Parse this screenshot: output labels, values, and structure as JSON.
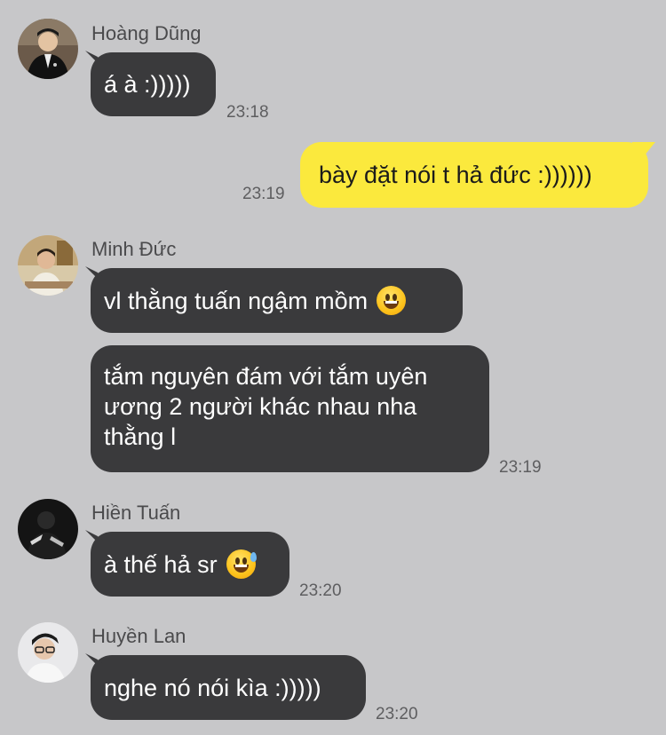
{
  "messages": [
    {
      "sender": "Hoàng Dũng",
      "text": "á à :)))))",
      "time": "23:18",
      "avatar": "avatar-man-suit"
    },
    {
      "sender": "me",
      "text": "bày đặt nói t hả đức :))))))",
      "time": "23:19"
    },
    {
      "sender": "Minh Đức",
      "text": "vl thằng tuấn ngậm mồm",
      "emoji": "grinning-face-icon"
    },
    {
      "sender": "Minh Đức",
      "text": "tắm nguyên đám với tắm uyên ương 2 người khác nhau nha thằng l",
      "time": "23:19"
    },
    {
      "sender": "Hiền Tuấn",
      "text": "à thế hả sr",
      "emoji": "grinning-sweat-face-icon",
      "time": "23:20"
    },
    {
      "sender": "Huyền Lan",
      "text": "nghe nó nói kìa :)))))",
      "time": "23:20"
    }
  ],
  "colors": {
    "background": "#c7c7c9",
    "incoming_bubble": "#3a3a3c",
    "outgoing_bubble": "#fbe93d",
    "sender_name": "#4a4a4c",
    "timestamp": "#5e5e60"
  }
}
